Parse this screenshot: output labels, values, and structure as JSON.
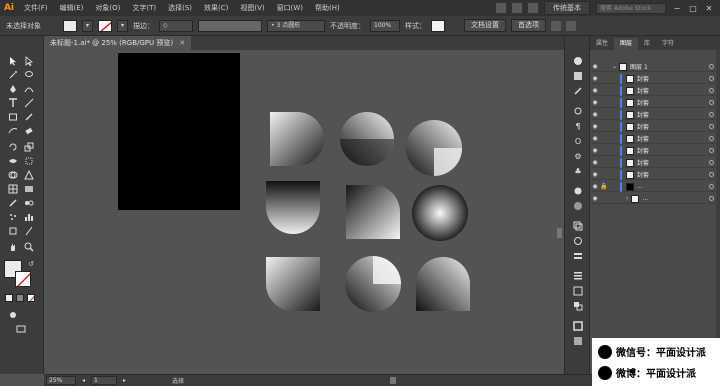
{
  "menubar": {
    "logo": "Ai",
    "items": [
      "文件(F)",
      "编辑(E)",
      "对象(O)",
      "文字(T)",
      "选择(S)",
      "效果(C)",
      "视图(V)",
      "窗口(W)",
      "帮助(H)"
    ],
    "workspace": "传统基本",
    "search_placeholder": "搜索 Adobe Stock"
  },
  "controlbar": {
    "selection_label": "未选择对象",
    "stroke_label": "描边：",
    "brush_label": "3 点圆形",
    "opacity_label": "不透明度：",
    "opacity_value": "100%",
    "style_label": "样式：",
    "doc_settings": "文档设置",
    "preferences": "首选项"
  },
  "document": {
    "tab_title": "未标题-1.ai* @ 25% (RGB/GPU 预览)"
  },
  "layers_panel": {
    "tabs": [
      "属性",
      "图层",
      "库",
      "字符"
    ],
    "active_tab": "图层",
    "parent_layer": "图层 1",
    "rows": [
      "封套",
      "封套",
      "封套",
      "封套",
      "封套",
      "封套",
      "封套",
      "封套",
      "封套",
      "...",
      "..."
    ]
  },
  "statusbar": {
    "zoom": "25%",
    "artboard": "1",
    "status_text": "选择"
  },
  "watermark": {
    "line1": "微信号：平面设计派",
    "line2": "微博：平面设计派"
  },
  "colors": {
    "accent_blue": "#4c7dff",
    "logo_orange": "#ff9a00"
  }
}
